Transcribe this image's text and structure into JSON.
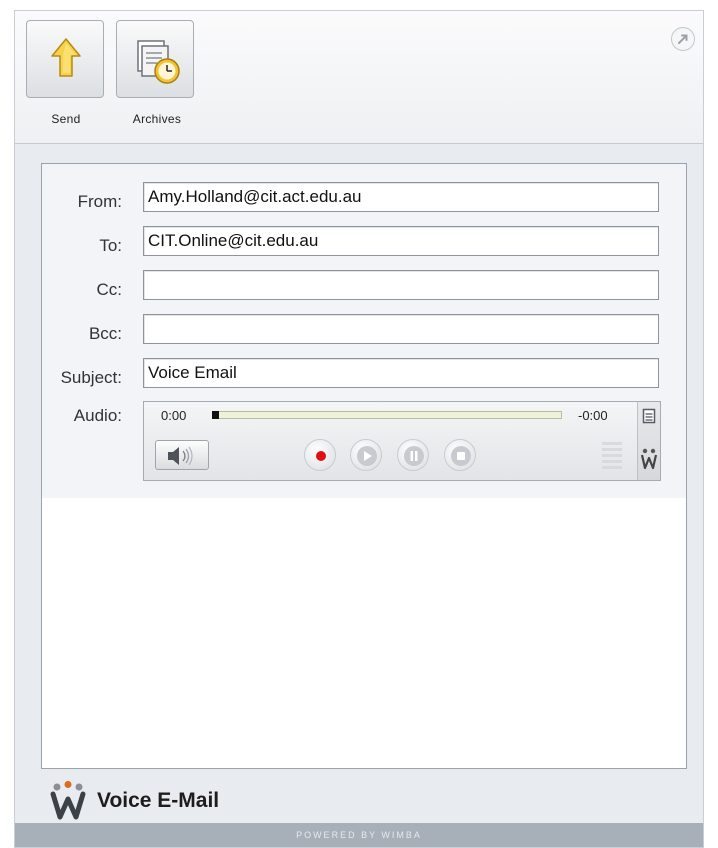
{
  "toolbar": {
    "send_label": "Send",
    "archives_label": "Archives",
    "send_icon": "up-arrow-icon",
    "archives_icon": "clock-document-icon",
    "popout_icon": "popout-arrow-icon"
  },
  "form": {
    "from_label": "From:",
    "from_value": "Amy.Holland@cit.act.edu.au",
    "to_label": "To:",
    "to_value": "CIT.Online@cit.edu.au",
    "cc_label": "Cc:",
    "cc_value": "",
    "bcc_label": "Bcc:",
    "bcc_value": "",
    "subject_label": "Subject:",
    "subject_value": "Voice Email",
    "audio_label": "Audio:"
  },
  "player": {
    "elapsed": "0:00",
    "remaining": "-0:00",
    "progress": 0,
    "controls": [
      "record",
      "play",
      "pause",
      "stop"
    ],
    "record_color": "#e01010"
  },
  "brand": {
    "title": "Voice E-Mail",
    "logo_icon": "wimba-logo-icon"
  },
  "footer": {
    "text": "POWERED BY WIMBA"
  },
  "colors": {
    "frame_bg": "#e8ebef",
    "footer_bg": "#a7afb8",
    "send_arrow": "#f1c232"
  }
}
